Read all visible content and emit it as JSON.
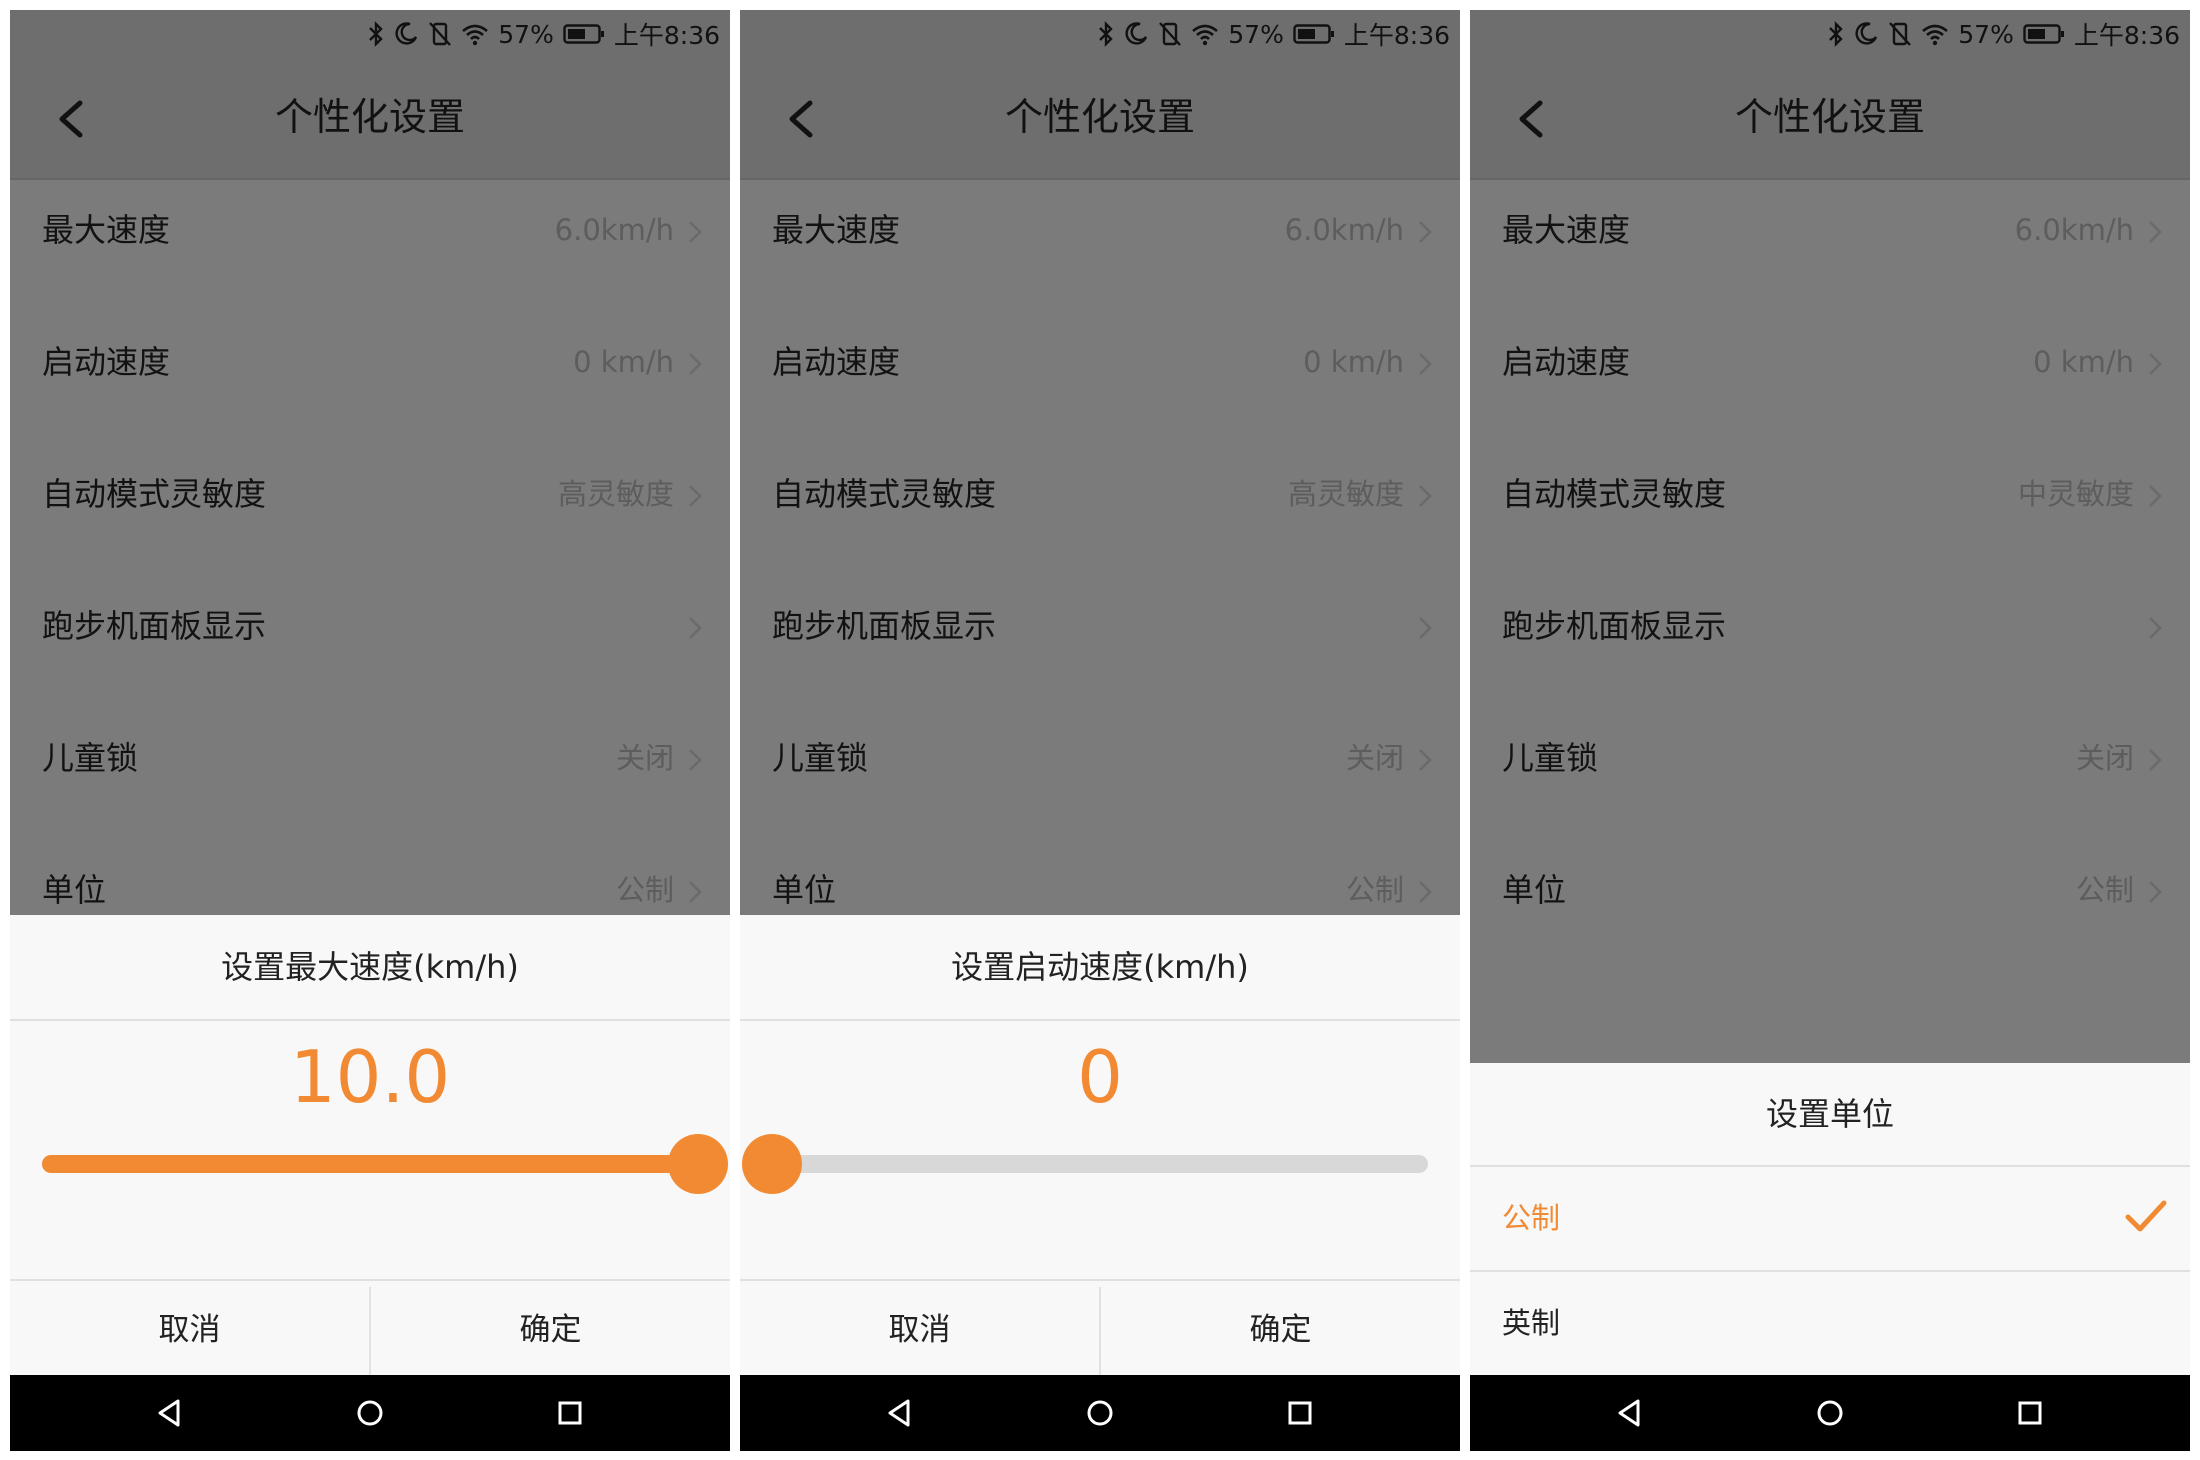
{
  "status": {
    "percent": "57%",
    "time": "上午8:36"
  },
  "header": {
    "title": "个性化设置"
  },
  "settings": [
    {
      "label": "最大速度",
      "value": "6.0km/h"
    },
    {
      "label": "启动速度",
      "value": "0 km/h"
    },
    {
      "label": "自动模式灵敏度",
      "value": "高灵敏度"
    },
    {
      "label": "跑步机面板显示",
      "value": ""
    },
    {
      "label": "儿童锁",
      "value": "关闭"
    },
    {
      "label": "单位",
      "value": "公制"
    }
  ],
  "panel3_settings": {
    "sensitivity": "中灵敏度"
  },
  "dialog1": {
    "title": "设置最大速度(km/h)",
    "value": "10.0",
    "progress": 1.0,
    "cancel": "取消",
    "confirm": "确定"
  },
  "dialog2": {
    "title": "设置启动速度(km/h)",
    "value": "0",
    "progress": 0.0,
    "cancel": "取消",
    "confirm": "确定"
  },
  "dialog3": {
    "title": "设置单位",
    "options": [
      {
        "label": "公制",
        "selected": true
      },
      {
        "label": "英制",
        "selected": false
      }
    ]
  },
  "colors": {
    "accent": "#f28a33",
    "overlay": "#7b7b7b",
    "sheet": "#f8f8f8",
    "navbar": "#000000"
  },
  "icons": [
    "bluetooth-icon",
    "moon-icon",
    "vibrate-off-icon",
    "wifi-icon",
    "battery-icon",
    "back-arrow-icon",
    "chevron-right-icon",
    "checkmark-icon",
    "nav-back-icon",
    "nav-home-icon",
    "nav-recents-icon"
  ]
}
